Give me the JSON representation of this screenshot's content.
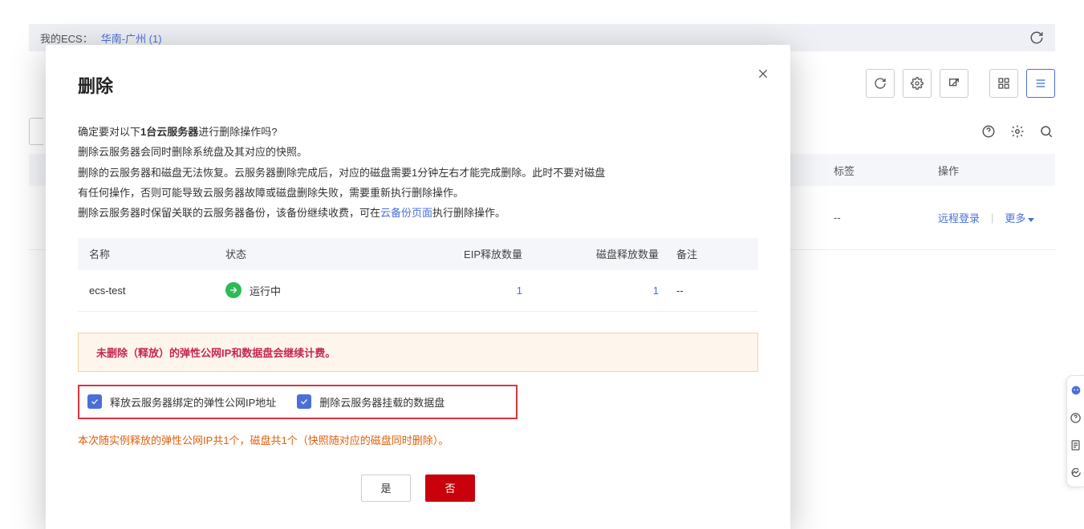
{
  "bg": {
    "my_ecs_label": "我的ECS：",
    "region_link": "华南-广州 (1)",
    "header_cols": {
      "tags": "标签",
      "ops": "操作"
    },
    "row_dashes": "--",
    "remote_login": "远程登录",
    "more": "更多"
  },
  "modal": {
    "title": "删除",
    "confirm_line_prefix": "确定要对以下",
    "confirm_line_bold": "1台云服务器",
    "confirm_line_suffix": "进行删除操作吗?",
    "line2": "删除云服务器会同时删除系统盘及其对应的快照。",
    "line3a": "删除的云服务器和磁盘无法恢复。云服务器删除完成后，对应的磁盘需要1分钟左右才能完成删除。此时不要对磁盘",
    "line3b": "有任何操作，否则可能导致云服务器故障或磁盘删除失败，需要重新执行删除操作。",
    "line4a": "删除云服务器时保留关联的云服务器备份，该备份继续收费，可在",
    "line4_link": "云备份页面",
    "line4b": "执行删除操作。",
    "table": {
      "head": {
        "name": "名称",
        "status": "状态",
        "eip": "EIP释放数量",
        "disk": "磁盘释放数量",
        "remark": "备注"
      },
      "row": {
        "name": "ecs-test",
        "status": "运行中",
        "eip": "1",
        "disk": "1",
        "remark": "--"
      }
    },
    "warning": "未删除（释放）的弹性公网IP和数据盘会继续计费。",
    "opt1": "释放云服务器绑定的弹性公网IP地址",
    "opt2": "删除云服务器挂载的数据盘",
    "release_note": "本次随实例释放的弹性公网IP共1个，磁盘共1个（快照随对应的磁盘同时删除）。",
    "btn_yes": "是",
    "btn_no": "否"
  }
}
